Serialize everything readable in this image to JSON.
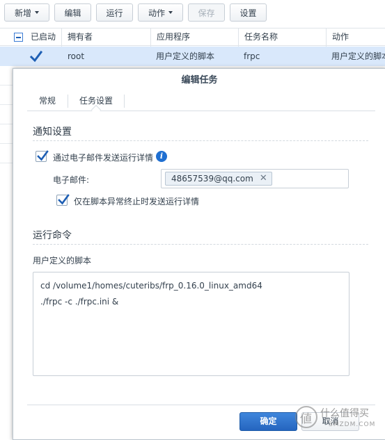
{
  "toolbar": {
    "new_label": "新增",
    "edit_label": "编辑",
    "run_label": "运行",
    "action_label": "动作",
    "save_label": "保存",
    "settings_label": "设置"
  },
  "grid": {
    "columns": [
      "已启动",
      "拥有者",
      "应用程序",
      "任务名称",
      "动作"
    ],
    "selected_row": {
      "enabled": true,
      "owner": "root",
      "application": "用户定义的脚本",
      "task_name": "frpc",
      "action": "用户定义的脚本"
    }
  },
  "dialog": {
    "title": "编辑任务",
    "tabs": [
      {
        "label": "常规",
        "active": false
      },
      {
        "label": "任务设置",
        "active": true
      }
    ],
    "notify": {
      "section_title": "通知设置",
      "send_email_label": "通过电子邮件发送运行详情",
      "send_email_checked": true,
      "email_label": "电子邮件:",
      "email_value": "48657539@qq.com",
      "abnormal_only_label": "仅在脚本异常终止时发送运行详情",
      "abnormal_only_checked": true
    },
    "command": {
      "section_title": "运行命令",
      "script_label": "用户定义的脚本",
      "script_lines": [
        "cd /volume1/homes/cuteribs/frp_0.16.0_linux_amd64",
        "./frpc -c ./frpc.ini &"
      ]
    },
    "ok_label": "确定",
    "cancel_label": "取消"
  },
  "watermark": {
    "line1": "什么值得买",
    "line2": "SMZDM.COM"
  },
  "colors": {
    "accent": "#2a6cc6",
    "selected_row": "#d9e8fb",
    "info_icon": "#1f6fd1"
  },
  "icons": {
    "check": "checkmark-icon",
    "info": "info-icon",
    "close": "close-icon",
    "dropdown": "chevron-down-icon"
  }
}
